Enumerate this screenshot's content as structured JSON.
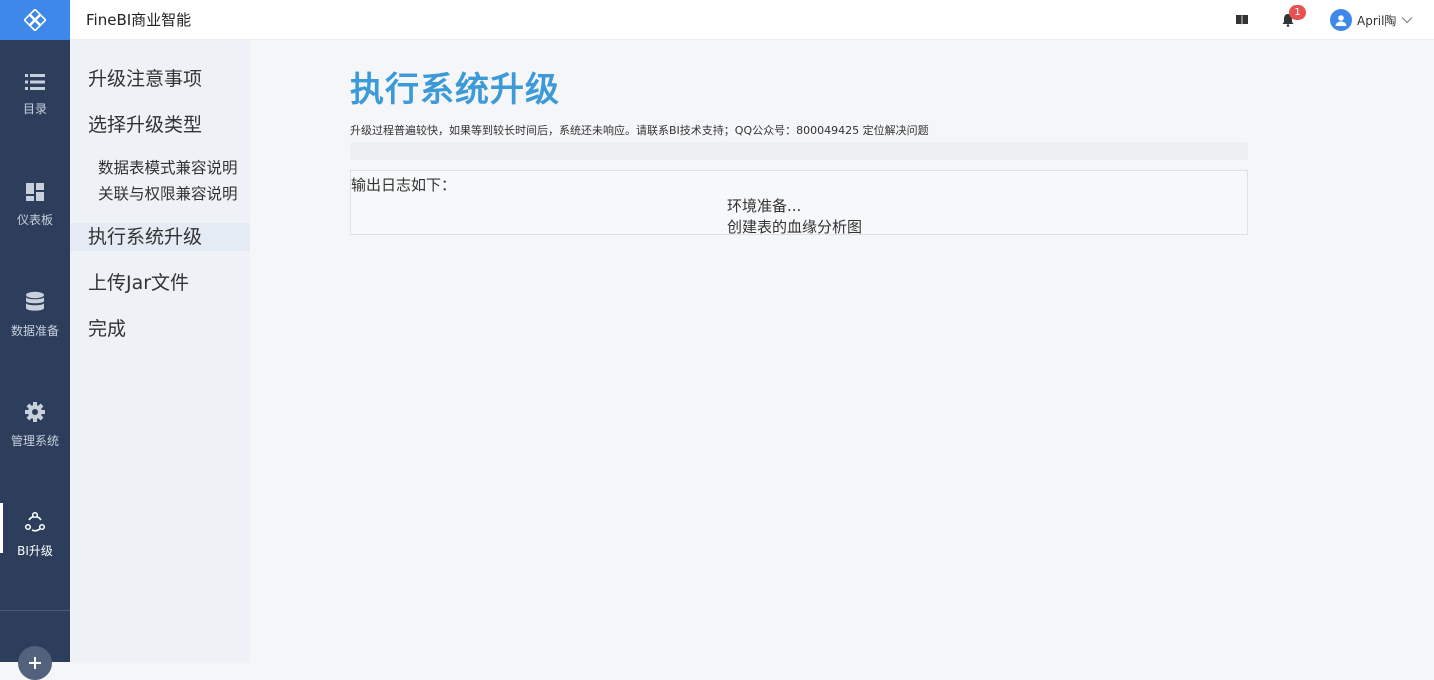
{
  "header": {
    "app_title": "FineBI商业智能",
    "notification_count": "1",
    "username": "April陶",
    "accent_color": "#3d88e8",
    "icons": [
      "logo-icon",
      "book-icon",
      "bell-icon",
      "user-icon",
      "chevron-down-icon"
    ]
  },
  "leftnav": {
    "items": [
      {
        "label": "目录",
        "icon": "list-icon"
      },
      {
        "label": "仪表板",
        "icon": "dashboard-icon"
      },
      {
        "label": "数据准备",
        "icon": "database-icon"
      },
      {
        "label": "管理系统",
        "icon": "gear-icon"
      },
      {
        "label": "BI升级",
        "icon": "upgrade-icon",
        "active": true
      }
    ],
    "add_icon": "plus-icon"
  },
  "steps": {
    "items": [
      {
        "label": "升级注意事项"
      },
      {
        "label": "选择升级类型"
      },
      {
        "label": "数据表模式兼容说明",
        "sub": true
      },
      {
        "label": "关联与权限兼容说明",
        "sub": true
      },
      {
        "label": "执行系统升级",
        "active": true
      },
      {
        "label": "上传Jar文件"
      },
      {
        "label": "完成"
      }
    ]
  },
  "main": {
    "title": "执行系统升级",
    "title_color": "#3d9ad8",
    "notice": "升级过程普遍较快，如果等到较长时间后，系统还未响应。请联系BI技术支持；QQ公众号：800049425 定位解决问题",
    "log_heading": "输出日志如下：",
    "log_lines": [
      "环境准备...",
      "创建表的血缘分析图"
    ]
  }
}
